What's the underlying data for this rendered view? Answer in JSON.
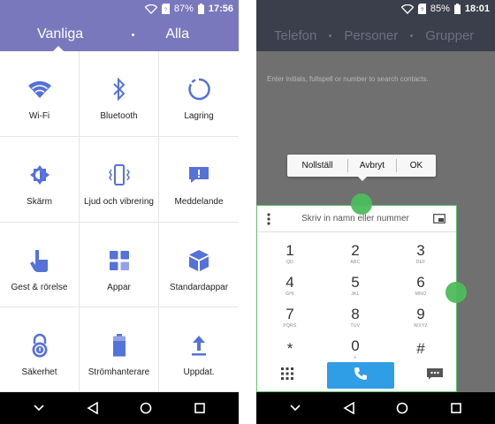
{
  "left": {
    "status": {
      "battery": "87%",
      "time": "17:56"
    },
    "tabs": {
      "active": "Vanliga",
      "other": "Alla"
    },
    "tiles": [
      {
        "label": "Wi-Fi",
        "icon": "wifi-icon"
      },
      {
        "label": "Bluetooth",
        "icon": "bluetooth-icon"
      },
      {
        "label": "Lagring",
        "icon": "storage-ring-icon"
      },
      {
        "label": "Skärm",
        "icon": "brightness-icon"
      },
      {
        "label": "Ljud och vibrering",
        "icon": "vibrate-icon"
      },
      {
        "label": "Meddelande",
        "icon": "notification-icon"
      },
      {
        "label": "Gest & rörelse",
        "icon": "gesture-hand-icon"
      },
      {
        "label": "Appar",
        "icon": "apps-grid-icon"
      },
      {
        "label": "Standardappar",
        "icon": "default-apps-cube-icon"
      },
      {
        "label": "Säkerhet",
        "icon": "lock-icon"
      },
      {
        "label": "Strömhanterare",
        "icon": "battery-icon"
      },
      {
        "label": "Uppdat.",
        "icon": "update-arrow-icon"
      }
    ]
  },
  "right": {
    "status": {
      "battery": "85%",
      "time": "18:01"
    },
    "tabs": [
      "Telefon",
      "Personer",
      "Grupper"
    ],
    "hint": "Enter initials, fullspell or number to search contacts.",
    "menu": {
      "reset": "Nollställ",
      "cancel": "Avbryt",
      "ok": "OK"
    },
    "search_placeholder": "Skriv in namn eller nummer",
    "keys": [
      {
        "digit": "1",
        "letters": "QD"
      },
      {
        "digit": "2",
        "letters": "ABC"
      },
      {
        "digit": "3",
        "letters": "DEF"
      },
      {
        "digit": "4",
        "letters": "GHI"
      },
      {
        "digit": "5",
        "letters": "JKL"
      },
      {
        "digit": "6",
        "letters": "MNO"
      },
      {
        "digit": "7",
        "letters": "PQRS"
      },
      {
        "digit": "8",
        "letters": "TUV"
      },
      {
        "digit": "9",
        "letters": "WXYZ"
      },
      {
        "digit": "*",
        "letters": ""
      },
      {
        "digit": "0",
        "letters": "+"
      },
      {
        "digit": "#",
        "letters": ""
      }
    ]
  },
  "colors": {
    "accent_left": "#7a78bd",
    "icon_blue": "#5572d8",
    "call_blue": "#2f9ee6",
    "marker_green": "#4cbc5c"
  }
}
